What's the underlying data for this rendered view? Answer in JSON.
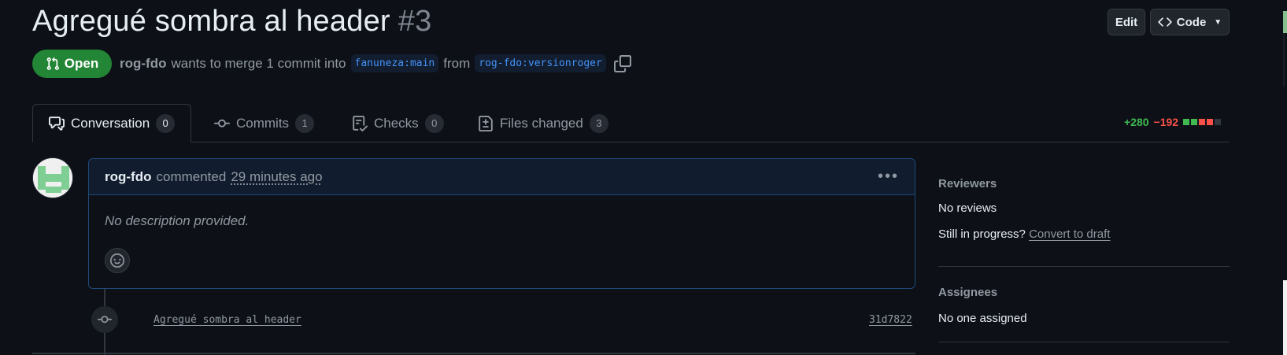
{
  "pr": {
    "title": "Agregué sombra al header",
    "number": "#3",
    "state": "Open",
    "author": "rog-fdo",
    "merge_text": "wants to merge 1 commit into",
    "base_branch": "fanuneza:main",
    "from_text": "from",
    "head_branch": "rog-fdo:versionroger"
  },
  "header_buttons": {
    "edit": "Edit",
    "code": "Code"
  },
  "tabs": [
    {
      "label": "Conversation",
      "count": "0",
      "icon": "comment-discussion-icon"
    },
    {
      "label": "Commits",
      "count": "1",
      "icon": "git-commit-icon"
    },
    {
      "label": "Checks",
      "count": "0",
      "icon": "checklist-icon"
    },
    {
      "label": "Files changed",
      "count": "3",
      "icon": "file-diff-icon"
    }
  ],
  "diffstat": {
    "additions": "+280",
    "deletions": "−192"
  },
  "comment": {
    "author": "rog-fdo",
    "action": "commented",
    "time": "29 minutes ago",
    "body": "No description provided."
  },
  "timeline": {
    "commit_message": "Agregué sombra al header",
    "commit_sha": "31d7822"
  },
  "sidebar": {
    "reviewers": {
      "heading": "Reviewers",
      "value": "No reviews",
      "draft_prompt": "Still in progress?",
      "draft_link": "Convert to draft"
    },
    "assignees": {
      "heading": "Assignees",
      "value": "No one assigned"
    }
  },
  "colors": {
    "background": "#0d1117",
    "open_green": "#238636",
    "link_blue": "#4493f8",
    "addition": "#3fb950",
    "deletion": "#f85149"
  }
}
